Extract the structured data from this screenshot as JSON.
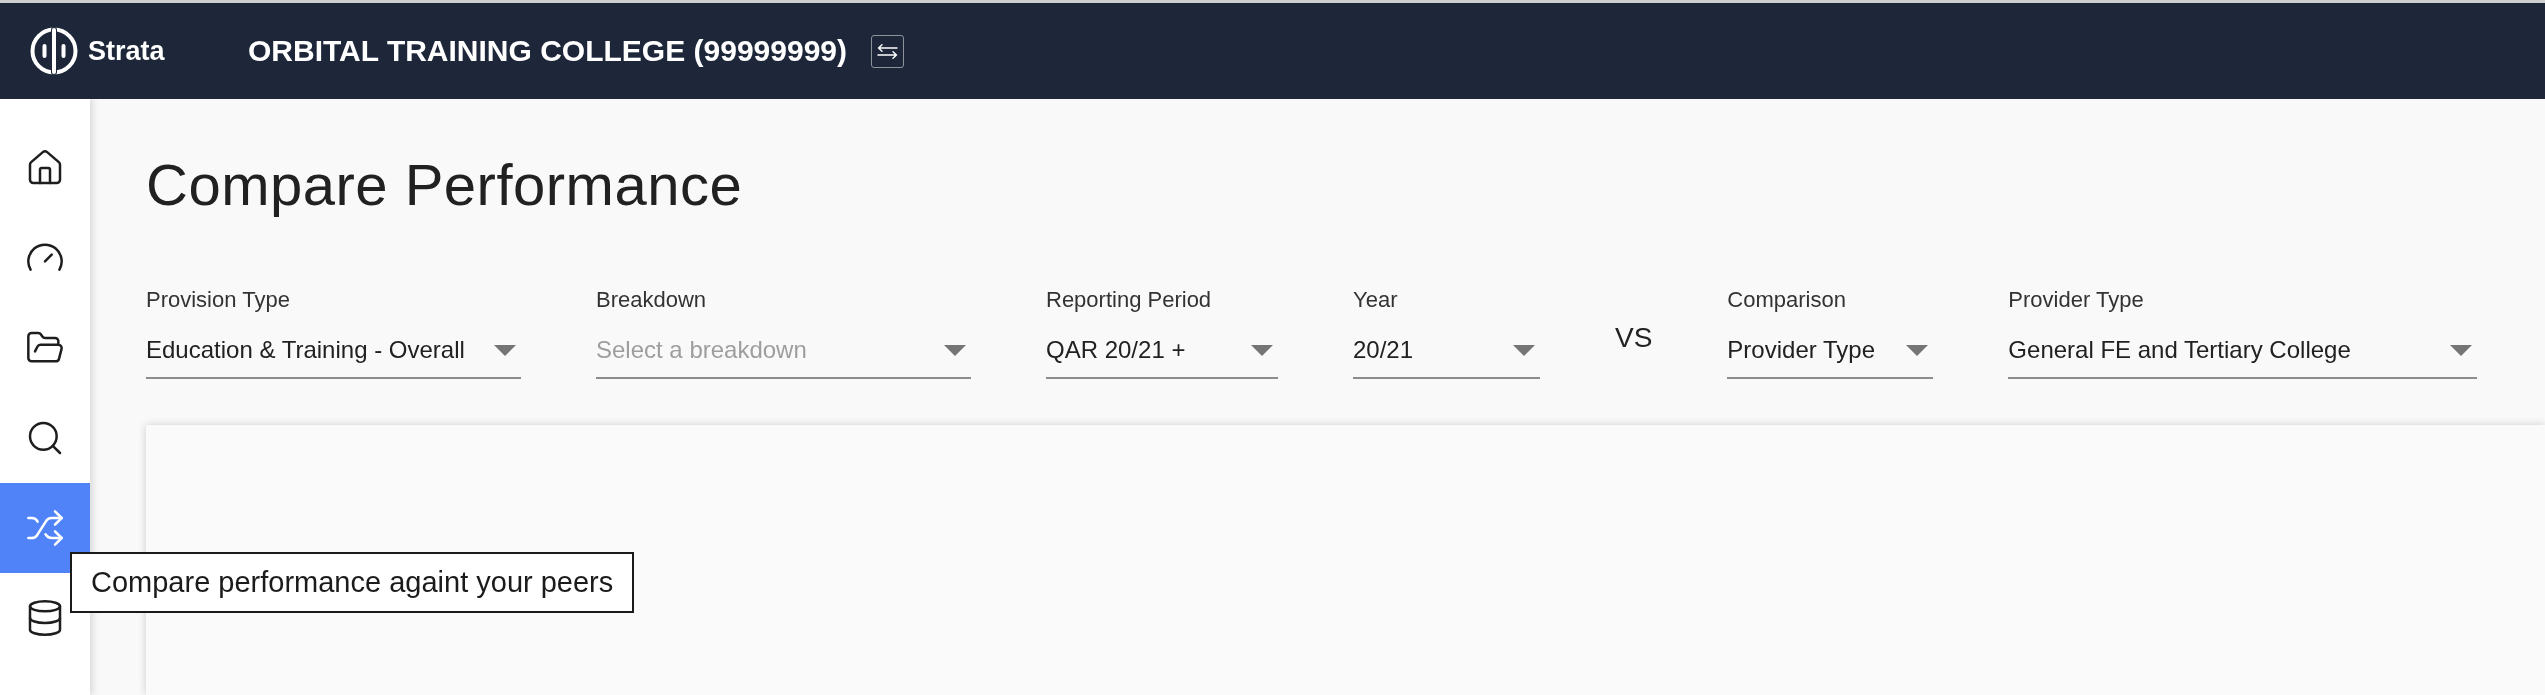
{
  "header": {
    "brand": "Strata",
    "organisation": "ORBITAL TRAINING COLLEGE (99999999)"
  },
  "sidebar": {
    "items": [
      {
        "selected": false
      },
      {
        "selected": false
      },
      {
        "selected": false
      },
      {
        "selected": false
      },
      {
        "selected": true
      },
      {
        "selected": false
      }
    ]
  },
  "tooltip": {
    "text": "Compare performance againt your peers"
  },
  "page": {
    "title": "Compare Performance",
    "filters": [
      {
        "label": "Provision Type",
        "value": "Education & Training - Overall"
      },
      {
        "label": "Breakdown",
        "placeholder": "Select a breakdown"
      },
      {
        "label": "Reporting Period",
        "value": "QAR 20/21 +"
      },
      {
        "label": "Year",
        "value": "20/21"
      }
    ],
    "vs_label": "VS",
    "comparison_filters": [
      {
        "label": "Comparison",
        "value": "Provider Type"
      },
      {
        "label": "Provider Type",
        "value": "General FE and Tertiary College"
      }
    ]
  }
}
